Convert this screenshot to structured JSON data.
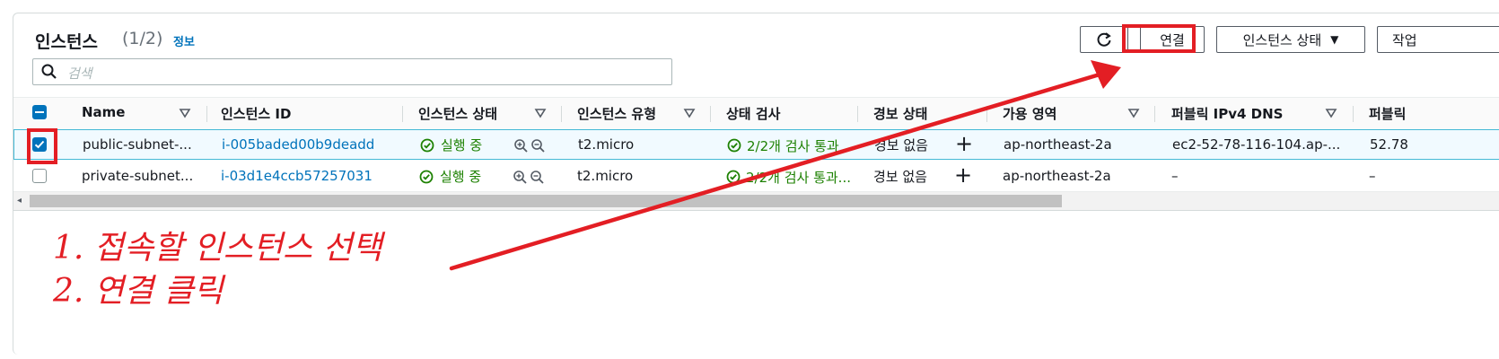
{
  "header": {
    "title": "인스턴스",
    "count": "(1/2)",
    "info_link": "정보"
  },
  "toolbar": {
    "connect_label": "연결",
    "state_label": "인스턴스 상태",
    "state_caret": "▼",
    "actions_label": "작업"
  },
  "search": {
    "placeholder": "검색"
  },
  "table": {
    "columns": [
      "Name",
      "인스턴스 ID",
      "인스턴스 상태",
      "인스턴스 유형",
      "상태 검사",
      "경보 상태",
      "가용 영역",
      "퍼블릭 IPv4 DNS",
      "퍼블릭"
    ],
    "rows": [
      {
        "selected": true,
        "name": "public-subnet-...",
        "instance_id": "i-005baded00b9deadd",
        "state": "실행 중",
        "type": "t2.micro",
        "status_check": "2/2개 검사 통과",
        "alarm": "경보 없음",
        "az": "ap-northeast-2a",
        "public_dns": "ec2-52-78-116-104.ap-...",
        "public_ip": "52.78"
      },
      {
        "selected": false,
        "name": "private-subnet...",
        "instance_id": "i-03d1e4ccb57257031",
        "state": "실행 중",
        "type": "t2.micro",
        "status_check": "2/2개 검사 통과...",
        "alarm": "경보 없음",
        "az": "ap-northeast-2a",
        "public_dns": "–",
        "public_ip": "–"
      }
    ]
  },
  "annotations": {
    "step1": "1. 접속할 인스턴스 선택",
    "step2": "2. 연결 클릭"
  },
  "colors": {
    "accent": "#0073bb",
    "ok": "#1d8102",
    "annotation": "#e31e24"
  },
  "icons": [
    "refresh-icon",
    "search-icon",
    "sort-icon",
    "status-ok-icon",
    "zoom-in-icon",
    "zoom-out-icon",
    "add-icon",
    "checkbox-icon"
  ]
}
